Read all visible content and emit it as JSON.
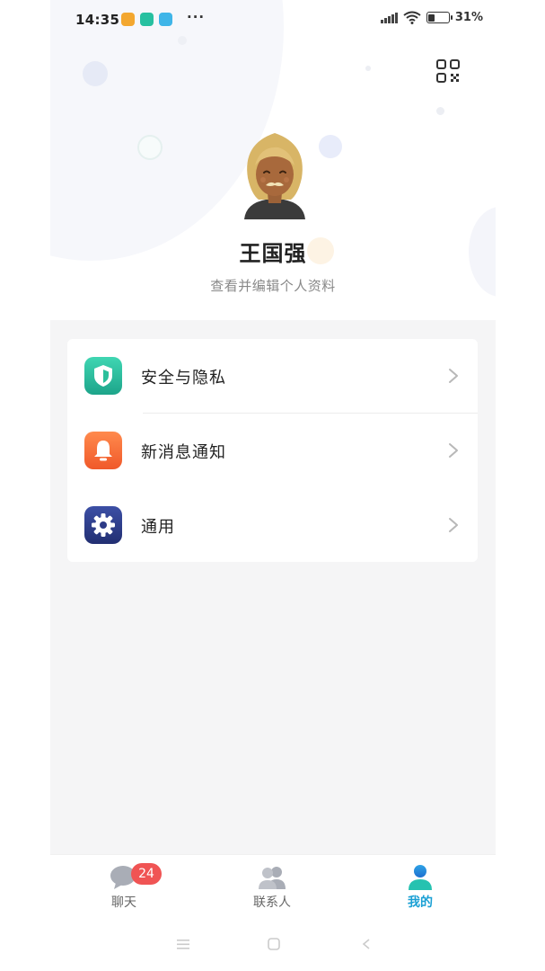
{
  "status_bar": {
    "time": "14:35",
    "more": "···",
    "battery_level": 0.31,
    "battery_text": "31%",
    "notification_icons": [
      "app-notification-icon",
      "app-notification-icon",
      "app-notification-icon"
    ]
  },
  "header": {
    "qr_icon": "qr-code-icon"
  },
  "profile": {
    "name": "王国强",
    "subtitle": "查看并编辑个人资料"
  },
  "menu": {
    "items": [
      {
        "label": "安全与隐私",
        "icon": "shield-icon",
        "color": "#22b897"
      },
      {
        "label": "新消息通知",
        "icon": "bell-icon",
        "color": "#f4683a"
      },
      {
        "label": "通用",
        "icon": "gear-icon",
        "color": "#2d3b87"
      }
    ]
  },
  "tab_bar": {
    "tabs": [
      {
        "label": "聊天",
        "icon": "chat-bubble-icon",
        "badge": "24"
      },
      {
        "label": "联系人",
        "icon": "contacts-icon"
      },
      {
        "label": "我的",
        "icon": "person-icon",
        "active": true
      }
    ],
    "active_color": "#1aa0d4",
    "badge_color": "#f05454"
  }
}
